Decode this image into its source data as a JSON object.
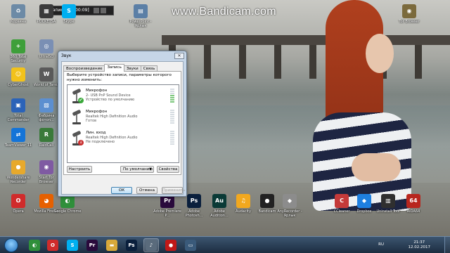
{
  "recorder": {
    "title": "Запись [00:00:09]"
  },
  "watermark": "www.Bandicam.com",
  "desktop_icons": [
    {
      "label": "Корзина",
      "icon": "recycle-bin-icon",
      "color": "#6c8aa6",
      "glyph": "♻"
    },
    {
      "label": "POCKETSA",
      "icon": "app-icon",
      "color": "#3a3a3a",
      "glyph": "▦"
    },
    {
      "label": "Skype",
      "icon": "skype-icon",
      "color": "#00aff0",
      "glyph": "S"
    },
    {
      "label": "PowerPoint - Ярлык",
      "icon": "shortcut-icon",
      "color": "#5b7fa6",
      "glyph": "▤"
    },
    {
      "label": "Tor Browser",
      "icon": "tor-browser-icon",
      "color": "#7b6a3c",
      "glyph": "◉"
    },
    {
      "label": "360 Total Security",
      "icon": "shield-icon",
      "color": "#3e9f3a",
      "glyph": "+"
    },
    {
      "label": "UltraISO",
      "icon": "disc-icon",
      "color": "#7a8fb4",
      "glyph": "◎"
    },
    {
      "label": "CyberGhost",
      "icon": "ghost-icon",
      "color": "#f2c21b",
      "glyph": "☺"
    },
    {
      "label": "World of Tanks",
      "icon": "wot-icon",
      "color": "#5a5a5a",
      "glyph": "W"
    },
    {
      "label": "Total Commander",
      "icon": "floppy-icon",
      "color": "#2b63b8",
      "glyph": "▣"
    },
    {
      "label": "Фабрика фотоп...",
      "icon": "photo-icon",
      "color": "#5c8fd0",
      "glyph": "▧"
    },
    {
      "label": "TeamViewer 11",
      "icon": "teamviewer-icon",
      "color": "#1474d8",
      "glyph": "⇄"
    },
    {
      "label": "RaidCall",
      "icon": "raidcall-icon",
      "color": "#3a7a3a",
      "glyph": "R"
    },
    {
      "label": "Wondershare Recorder",
      "icon": "recorder-icon",
      "color": "#e7a92c",
      "glyph": "●"
    },
    {
      "label": "Start Tor Browser",
      "icon": "onion-icon",
      "color": "#7f5aa2",
      "glyph": "◉"
    },
    {
      "label": "Opera",
      "icon": "opera-icon",
      "color": "#d02b2b",
      "glyph": "O"
    },
    {
      "label": "Mozilla Firefox",
      "icon": "firefox-icon",
      "color": "#e66000",
      "glyph": "◕"
    },
    {
      "label": "Google Chrome",
      "icon": "chrome-icon",
      "color": "#2f8f3a",
      "glyph": "◐"
    },
    {
      "label": "Adobe Premiere P...",
      "icon": "premiere-icon",
      "color": "#2a0a3c",
      "glyph": "Pr"
    },
    {
      "label": "Adobe Photosh...",
      "icon": "photoshop-icon",
      "color": "#0a1f3c",
      "glyph": "Ps"
    },
    {
      "label": "Adobe Audition...",
      "icon": "audition-icon",
      "color": "#0a3a36",
      "glyph": "Au"
    },
    {
      "label": "Audacity",
      "icon": "audacity-icon",
      "color": "#f2a81e",
      "glyph": "♫"
    },
    {
      "label": "Bandicam",
      "icon": "bandicam-icon",
      "color": "#222222",
      "glyph": "●"
    },
    {
      "label": "AnyRecorder - Ярлык",
      "icon": "rec-shortcut-icon",
      "color": "#8c8c8c",
      "glyph": "◆"
    },
    {
      "label": "CCleaner",
      "icon": "ccleaner-icon",
      "color": "#c43a3a",
      "glyph": "C"
    },
    {
      "label": "Dropbox",
      "icon": "dropbox-icon",
      "color": "#1e7fe0",
      "glyph": "◆"
    },
    {
      "label": "Uninstall Tool",
      "icon": "uninstall-icon",
      "color": "#2f2f2f",
      "glyph": "▥"
    },
    {
      "label": "AIDA64",
      "icon": "aida64-icon",
      "color": "#b8261e",
      "glyph": "64"
    }
  ],
  "dialog": {
    "title": "Звук",
    "tabs": [
      "Воспроизведение",
      "Запись",
      "Звуки",
      "Связь"
    ],
    "active_tab": 1,
    "description": "Выберите устройство записи, параметры которого нужно изменить:",
    "devices": [
      {
        "name": "Микрофон",
        "driver": "2- USB PnP Sound Device",
        "status": "Устройство по умолчанию",
        "badge": "✔",
        "badge_color": "#3aa83a",
        "level": 0.6
      },
      {
        "name": "Микрофон",
        "driver": "Realtek High Definition Audio",
        "status": "Готов",
        "badge": "",
        "badge_color": "",
        "level": 0.0
      },
      {
        "name": "Лин. вход",
        "driver": "Realtek High Definition Audio",
        "status": "Не подключено",
        "badge": "↓",
        "badge_color": "#c83030",
        "level": 0.0
      }
    ],
    "configure_label": "Настроить",
    "default_select": "По умолчанию",
    "properties_label": "Свойства",
    "ok_label": "ОК",
    "cancel_label": "Отмена",
    "apply_label": "Применить"
  },
  "taskbar": {
    "apps": [
      {
        "icon": "chrome-taskbar-icon",
        "color": "#2f8f3a",
        "glyph": "◐"
      },
      {
        "icon": "opera-taskbar-icon",
        "color": "#d02b2b",
        "glyph": "O"
      },
      {
        "icon": "skype-taskbar-icon",
        "color": "#00aff0",
        "glyph": "S"
      },
      {
        "icon": "premiere-taskbar-icon",
        "color": "#2a0a3c",
        "glyph": "Pr"
      },
      {
        "icon": "folder-taskbar-icon",
        "color": "#d8a93a",
        "glyph": "▬"
      },
      {
        "icon": "photoshop-taskbar-icon",
        "color": "#0a1f3c",
        "glyph": "Ps"
      },
      {
        "icon": "sound-taskbar-icon",
        "color": "#5a6b7c",
        "glyph": "♪"
      },
      {
        "icon": "bandicam-taskbar-icon",
        "color": "#c01818",
        "glyph": "●"
      },
      {
        "icon": "monitor-taskbar-icon",
        "color": "#3a5a7a",
        "glyph": "▭"
      }
    ],
    "lang": "RU",
    "time": "21:37",
    "date": "12.02.2017"
  }
}
